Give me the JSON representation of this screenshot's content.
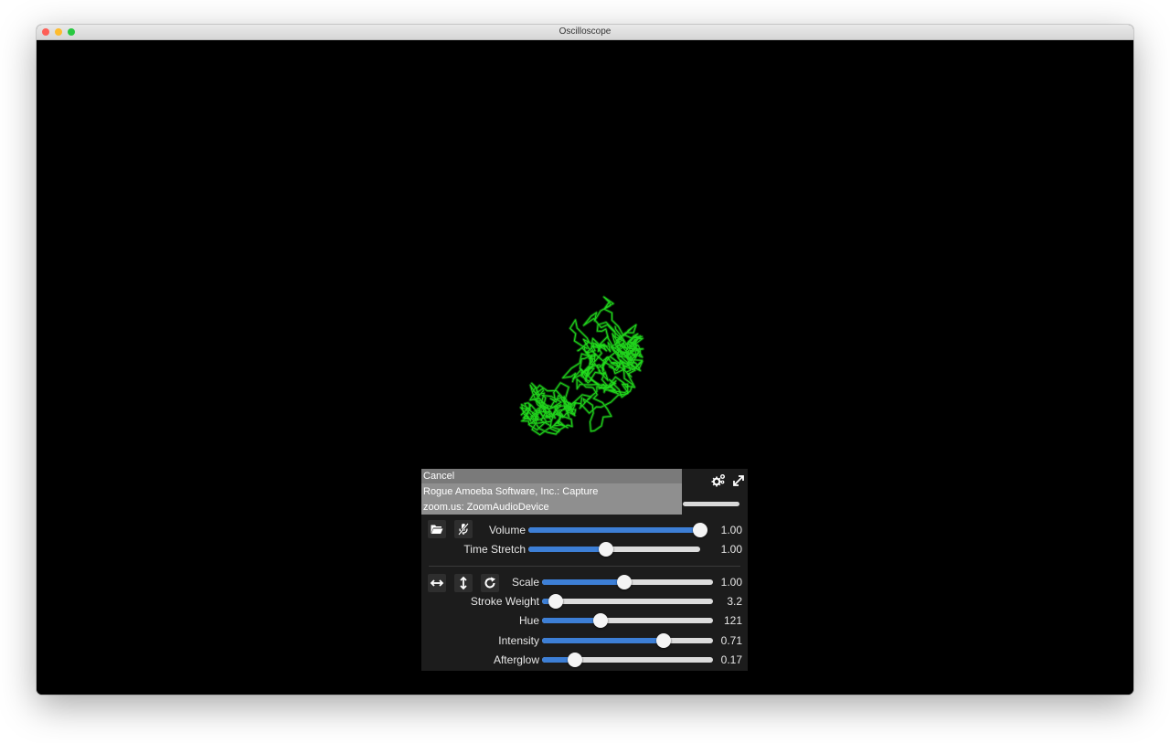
{
  "window": {
    "title": "Oscilloscope"
  },
  "scope": {
    "trace_color": "#22e01e"
  },
  "source_menu": {
    "items": [
      "Cancel",
      "Rogue Amoeba Software, Inc.: Capture",
      "zoom.us: ZoomAudioDevice"
    ]
  },
  "audio": {
    "volume": {
      "label": "Volume",
      "value": "1.00",
      "fraction": 1.0
    },
    "time_stretch": {
      "label": "Time Stretch",
      "value": "1.00",
      "fraction": 0.45
    }
  },
  "display": {
    "scale": {
      "label": "Scale",
      "value": "1.00",
      "fraction": 0.48
    },
    "stroke_weight": {
      "label": "Stroke Weight",
      "value": "3.2",
      "fraction": 0.08
    },
    "hue": {
      "label": "Hue",
      "value": "121",
      "fraction": 0.34
    },
    "intensity": {
      "label": "Intensity",
      "value": "0.71",
      "fraction": 0.71
    },
    "afterglow": {
      "label": "Afterglow",
      "value": "0.17",
      "fraction": 0.19
    }
  },
  "colors": {
    "accent": "#3d7fd6",
    "panel": "#1c1c1c",
    "menu": "#8f8f8f"
  },
  "icons": [
    "settings-gears-icon",
    "fullscreen-icon",
    "folder-open-icon",
    "microphone-muted-icon",
    "flip-horizontal-icon",
    "flip-vertical-icon",
    "rotate-icon"
  ]
}
